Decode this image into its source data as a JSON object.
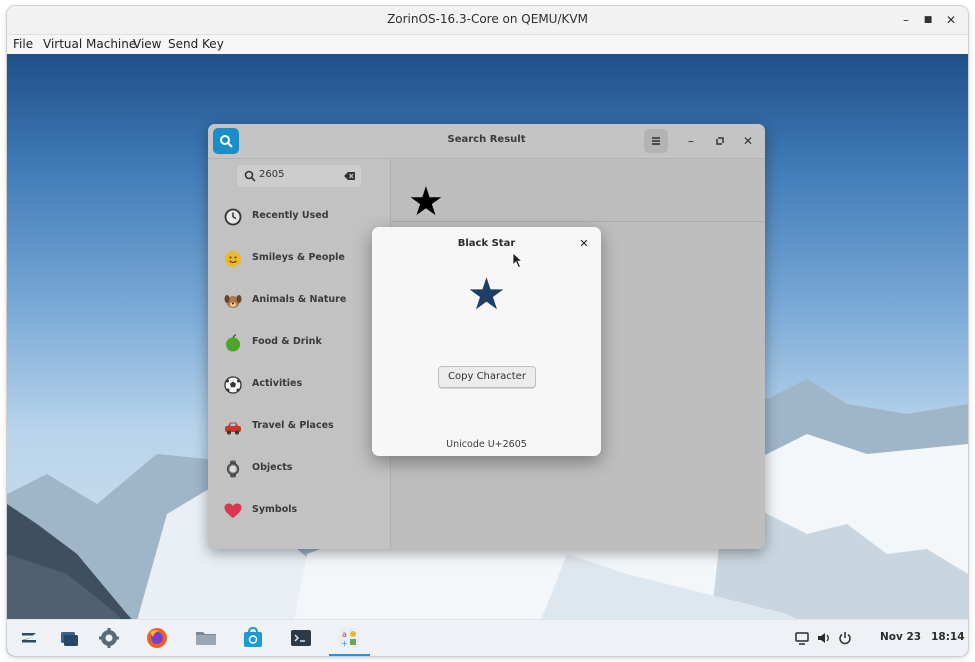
{
  "window": {
    "title": "ZorinOS-16.3-Core on QEMU/KVM",
    "controls": [
      "minimize-icon",
      "maximize-icon",
      "close-icon"
    ]
  },
  "menu": {
    "items": [
      {
        "label": "File"
      },
      {
        "label": "Virtual Machine"
      },
      {
        "label": "View"
      },
      {
        "label": "Send Key"
      }
    ]
  },
  "app": {
    "title": "Search Result",
    "search": {
      "value": "2605"
    },
    "categories": [
      {
        "label": "Recently Used",
        "icon": "clock-icon"
      },
      {
        "label": "Smileys & People",
        "icon": "smiley-icon"
      },
      {
        "label": "Animals & Nature",
        "icon": "dog-icon"
      },
      {
        "label": "Food & Drink",
        "icon": "apple-icon"
      },
      {
        "label": "Activities",
        "icon": "soccer-ball-icon"
      },
      {
        "label": "Travel & Places",
        "icon": "car-icon"
      },
      {
        "label": "Objects",
        "icon": "watch-icon"
      },
      {
        "label": "Symbols",
        "icon": "heart-icon"
      }
    ],
    "result_char": "★"
  },
  "dialog": {
    "title": "Black Star",
    "char": "★",
    "copy_label": "Copy Character",
    "code": "Unicode U+2605"
  },
  "taskbar": {
    "date": "Nov 23",
    "time": "18:14",
    "accent": "#2f8fd0"
  }
}
